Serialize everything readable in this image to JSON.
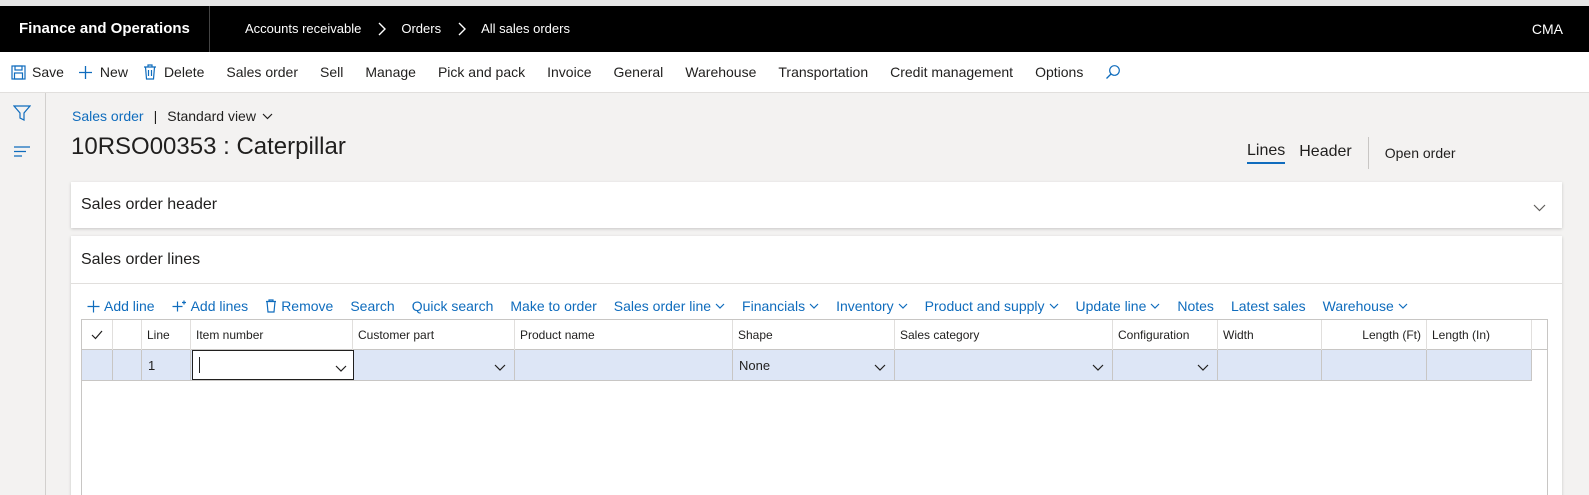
{
  "app": {
    "title": "Finance and Operations",
    "company": "CMA"
  },
  "breadcrumb": [
    "Accounts receivable",
    "Orders",
    "All sales orders"
  ],
  "actions": {
    "save": "Save",
    "new": "New",
    "delete": "Delete",
    "menus": [
      "Sales order",
      "Sell",
      "Manage",
      "Pick and pack",
      "Invoice",
      "General",
      "Warehouse",
      "Transportation",
      "Credit management",
      "Options"
    ]
  },
  "form": {
    "caption_link": "Sales order",
    "caption_sep": "|",
    "view": "Standard view",
    "title": "10RSO00353 : Caterpillar",
    "tabs": {
      "lines": "Lines",
      "header": "Header"
    },
    "open_order": "Open order"
  },
  "header_section": {
    "title": "Sales order header"
  },
  "lines_section": {
    "title": "Sales order lines",
    "toolbar": {
      "add_line": "Add line",
      "add_lines": "Add lines",
      "remove": "Remove",
      "search": "Search",
      "quick_search": "Quick search",
      "make_to_order": "Make to order",
      "sales_order_line": "Sales order line",
      "financials": "Financials",
      "inventory": "Inventory",
      "product_and_supply": "Product and supply",
      "update_line": "Update line",
      "notes": "Notes",
      "latest_sales": "Latest sales",
      "warehouse": "Warehouse"
    },
    "columns": {
      "line": "Line",
      "item_number": "Item number",
      "customer_part": "Customer part",
      "product_name": "Product name",
      "shape": "Shape",
      "sales_category": "Sales category",
      "configuration": "Configuration",
      "width": "Width",
      "length_ft": "Length (Ft)",
      "length_in": "Length (In)"
    },
    "rows": [
      {
        "line": "1",
        "item_number": "",
        "customer_part": "",
        "product_name": "",
        "shape": "None",
        "sales_category": "",
        "configuration": "",
        "width": "",
        "length_ft": "",
        "length_in": ""
      }
    ]
  },
  "colors": {
    "accent": "#0f6cbd",
    "topbar": "#000000",
    "selected_row": "#dde6f6"
  }
}
